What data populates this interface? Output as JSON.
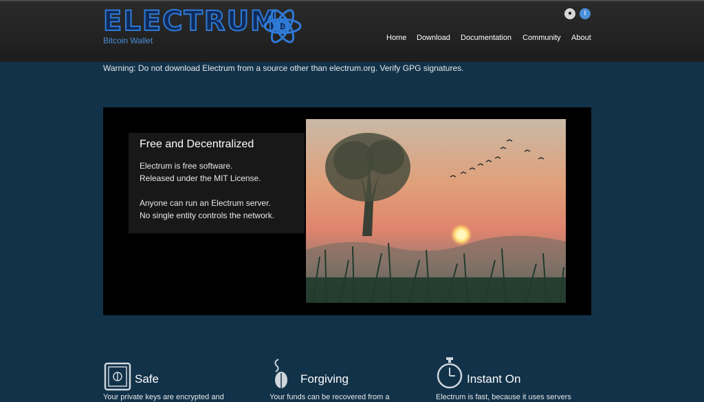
{
  "header": {
    "logo_text": "ELECTRUM",
    "logo_sub": "Bitcoin Wallet",
    "nav": [
      "Home",
      "Download",
      "Documentation",
      "Community",
      "About"
    ],
    "social": [
      "github-icon",
      "twitter-icon"
    ]
  },
  "warning": "Warning: Do not download Electrum from a source other than electrum.org. Verify GPG signatures.",
  "hero": {
    "title": "Free and Decentralized",
    "lines": [
      "Electrum is free software.",
      "Released under the MIT License.",
      "Anyone can run an Electrum server.",
      "No single entity controls the network."
    ]
  },
  "features": [
    {
      "icon": "safe-icon",
      "title": "Safe",
      "text": "Your private keys are encrypted and"
    },
    {
      "icon": "seed-icon",
      "title": "Forgiving",
      "text": "Your funds can be recovered from a"
    },
    {
      "icon": "stopwatch-icon",
      "title": "Instant On",
      "text": "Electrum is fast, because it uses servers"
    }
  ],
  "colors": {
    "background": "#123249",
    "header": "#222222",
    "logo_blue": "#2f7bd8"
  }
}
